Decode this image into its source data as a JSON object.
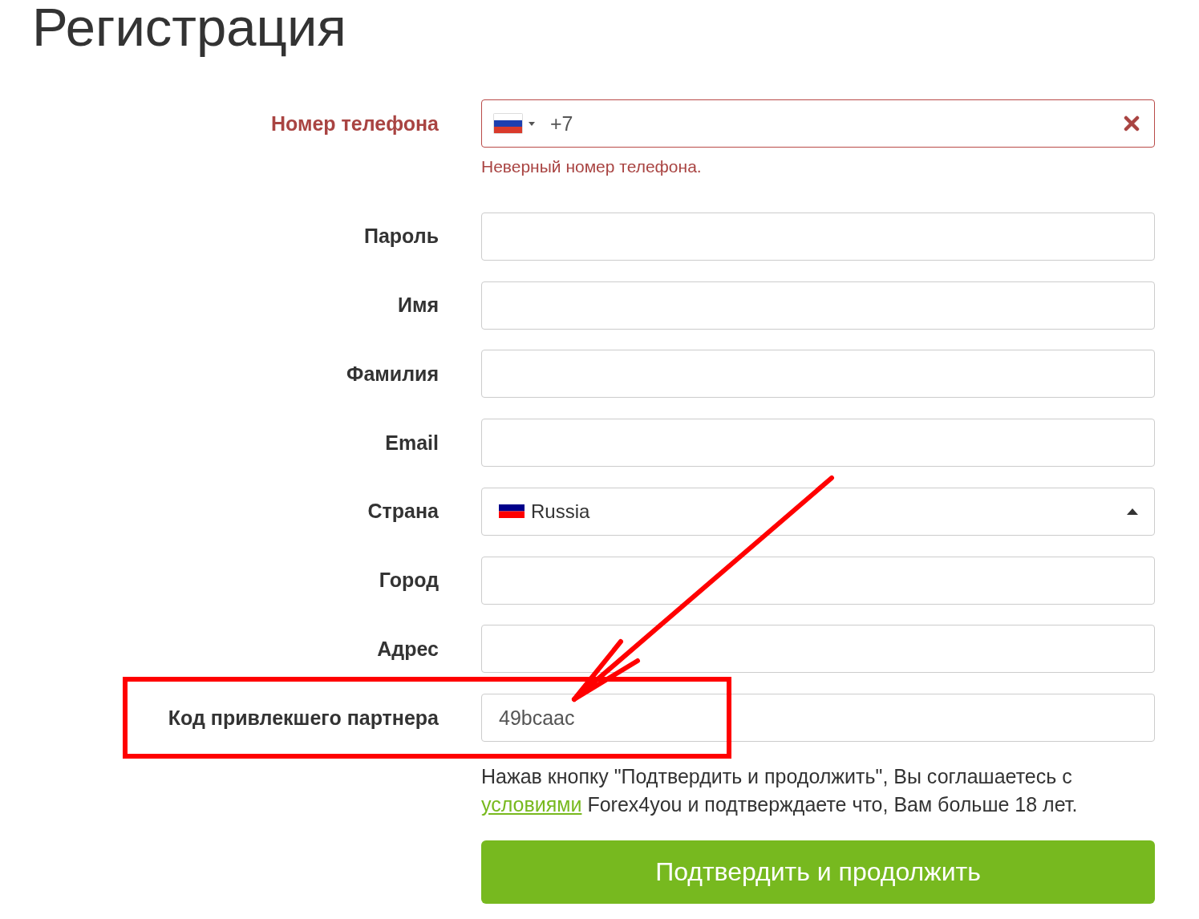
{
  "title": "Регистрация",
  "fields": [
    {
      "kind": "phone",
      "label": "Номер телефона",
      "value": "+7",
      "invalid": true,
      "highlighted": false,
      "error": "Неверный номер телефона."
    },
    {
      "kind": "password",
      "label": "Пароль",
      "invalid": false,
      "highlighted": false
    },
    {
      "kind": "text",
      "label": "Имя",
      "invalid": false,
      "highlighted": false
    },
    {
      "kind": "text",
      "label": "Фамилия",
      "invalid": false,
      "highlighted": false
    },
    {
      "kind": "text",
      "label": "Email",
      "invalid": false,
      "highlighted": false
    },
    {
      "kind": "select",
      "label": "Страна",
      "value": "Russia",
      "invalid": false,
      "highlighted": false
    },
    {
      "kind": "text",
      "label": "Город",
      "invalid": false,
      "highlighted": false
    },
    {
      "kind": "text",
      "label": "Адрес",
      "invalid": false,
      "highlighted": false
    },
    {
      "kind": "text",
      "label": "Код привлекшего партнера",
      "value": "49bcaac",
      "invalid": false,
      "highlighted": true
    }
  ],
  "agreement": {
    "text_before": "Нажав кнопку \"Подтвердить и продолжить\", Вы соглашаетесь с",
    "link": "условиями",
    "text_after": "Forex4you и подтверждаете что, Вам больше 18 лет."
  },
  "submit_button": {
    "label": "Подтвердить и продолжить"
  }
}
